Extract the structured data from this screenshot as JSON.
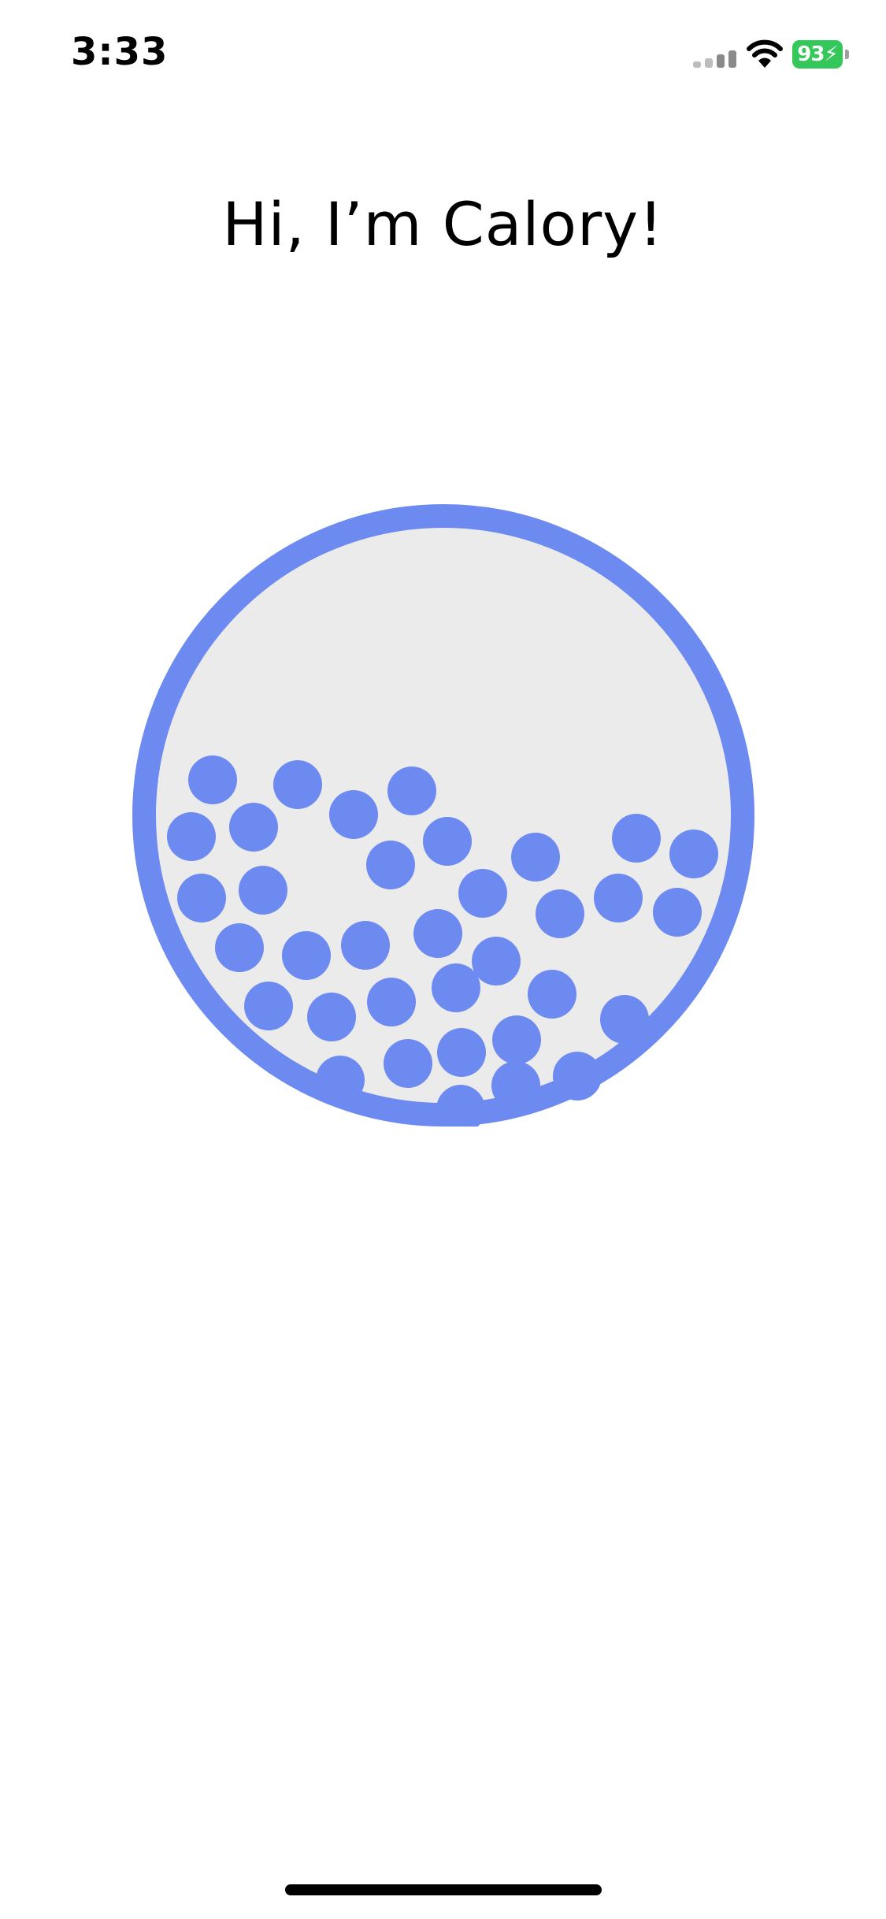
{
  "status_bar": {
    "time": "3:33",
    "battery_percent": "93",
    "icons": [
      "signal-icon",
      "wifi-icon",
      "battery-charging-icon"
    ]
  },
  "title": "Hi, I’m Calory!",
  "mascot": {
    "icon": "ball-jar-icon",
    "ring_color": "#6d8af0",
    "fill_color": "#ebebeb",
    "ball_color": "#6d8af0",
    "ball_count": 38
  },
  "colors": {
    "accent": "#6d8af0",
    "battery": "#34c759"
  }
}
